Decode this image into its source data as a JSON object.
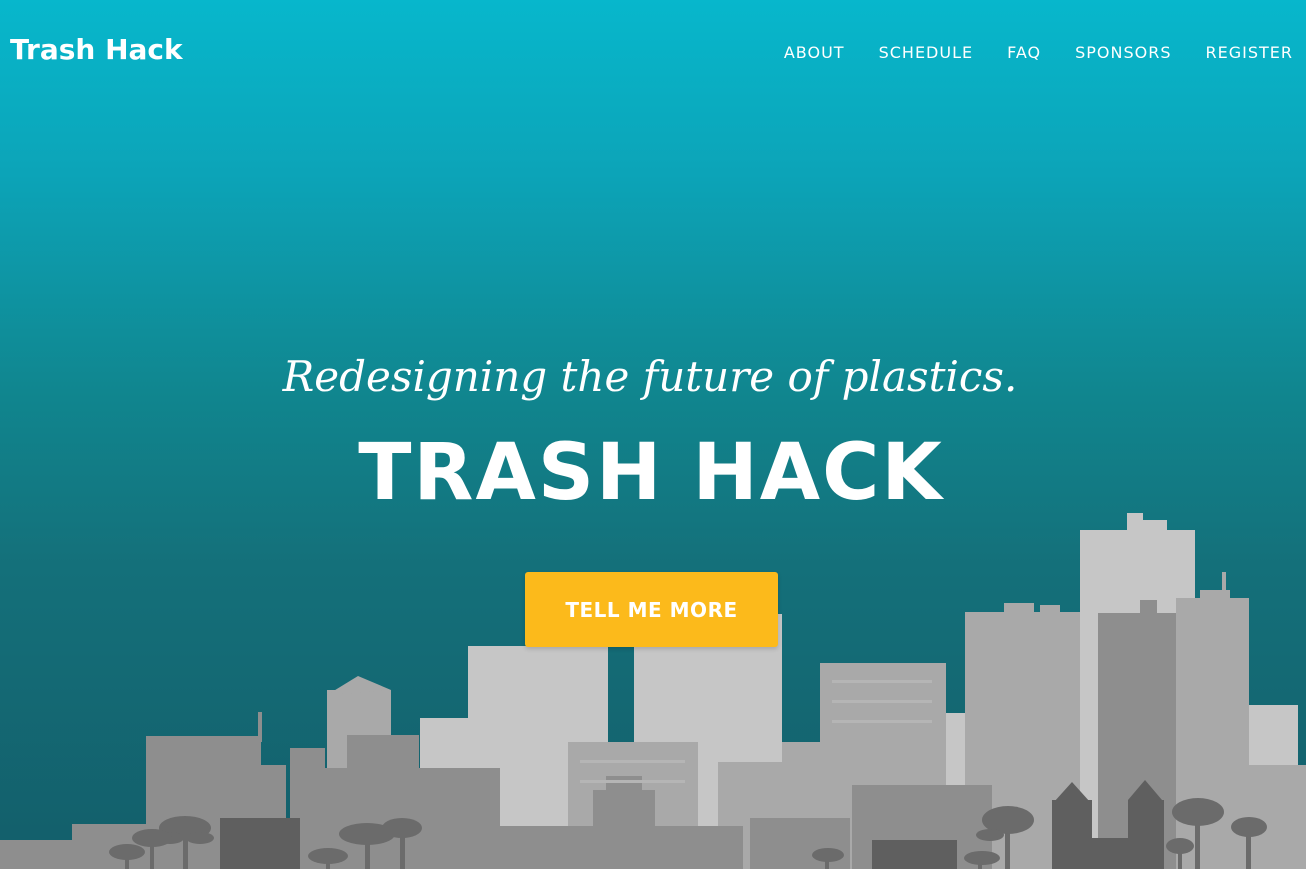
{
  "nav": {
    "brand": "Trash Hack",
    "items": [
      {
        "label": "ABOUT"
      },
      {
        "label": "SCHEDULE"
      },
      {
        "label": "FAQ"
      },
      {
        "label": "SPONSORS"
      },
      {
        "label": "REGISTER"
      }
    ]
  },
  "hero": {
    "tagline": "Redesigning the future of plastics.",
    "headline": "TRASH HACK",
    "cta_label": "TELL ME MORE"
  },
  "colors": {
    "gradient_top": "#07b7cc",
    "gradient_bottom": "#135e6a",
    "accent": "#fcba1b",
    "text": "#ffffff"
  },
  "illustration": "city-skyline-with-palm-trees"
}
